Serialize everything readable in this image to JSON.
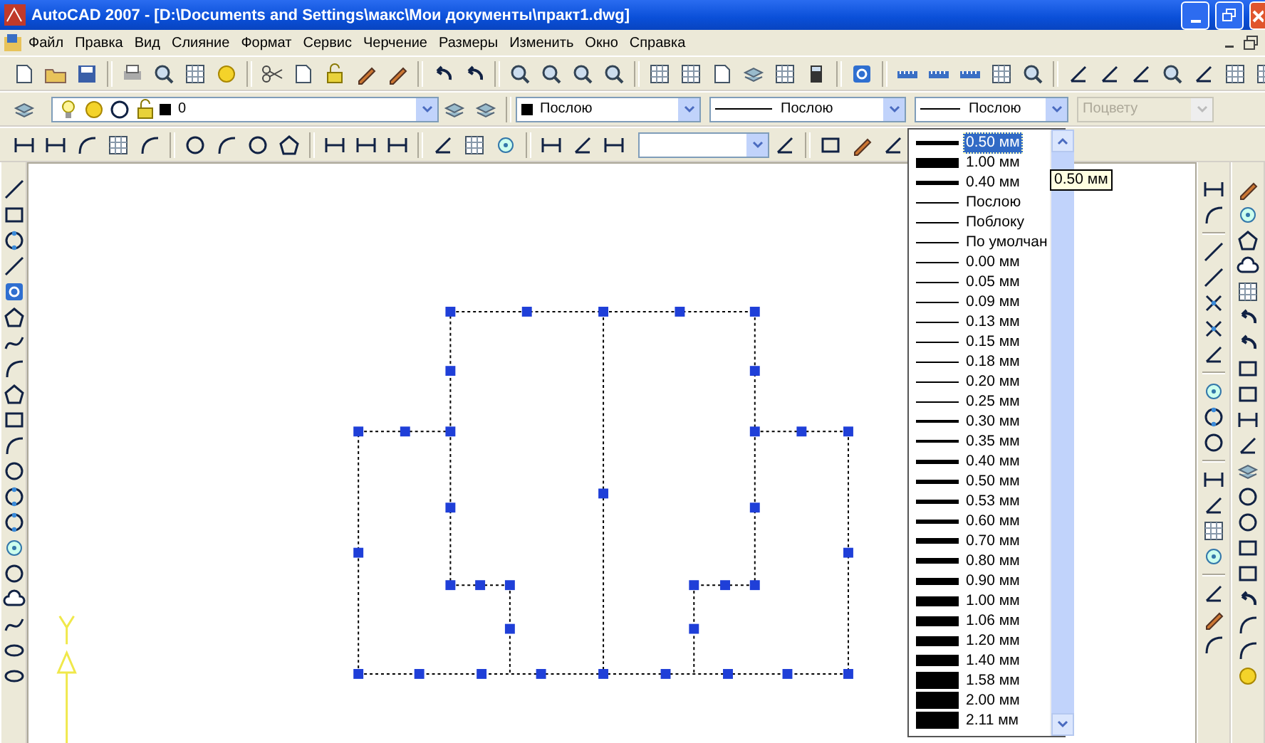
{
  "window": {
    "title": "AutoCAD 2007 - [D:\\Documents and Settings\\макс\\Мои документы\\практ1.dwg]"
  },
  "menu": [
    "Файл",
    "Правка",
    "Вид",
    "Слияние",
    "Формат",
    "Сервис",
    "Черчение",
    "Размеры",
    "Изменить",
    "Окно",
    "Справка"
  ],
  "properties_bar": {
    "layer": {
      "value": "0"
    },
    "color": {
      "value": "Послою"
    },
    "linetype": {
      "value": "Послою"
    },
    "lineweight": {
      "value": "Послою"
    },
    "plot_style": {
      "value": "Поцвету",
      "disabled": true
    }
  },
  "lineweight_list": {
    "tooltip": "0.50 мм",
    "items": [
      {
        "label": "0.50 мм",
        "kind": "medium",
        "selected": true
      },
      {
        "label": "1.00 мм",
        "kind": "heavy",
        "selected": false
      },
      {
        "label": "0.40 мм",
        "kind": "medium",
        "selected": false
      },
      {
        "label": "Послою",
        "kind": "hairline",
        "selected": false
      },
      {
        "label": "Поблоку",
        "kind": "hairline",
        "selected": false
      },
      {
        "label": "По умолчан",
        "kind": "hairline",
        "selected": false
      },
      {
        "label": "0.00 мм",
        "kind": "hairline",
        "selected": false
      },
      {
        "label": "0.05 мм",
        "kind": "hairline",
        "selected": false
      },
      {
        "label": "0.09 мм",
        "kind": "hairline",
        "selected": false
      },
      {
        "label": "0.13 мм",
        "kind": "hairline",
        "selected": false
      },
      {
        "label": "0.15 мм",
        "kind": "hairline",
        "selected": false
      },
      {
        "label": "0.18 мм",
        "kind": "hairline",
        "selected": false
      },
      {
        "label": "0.20 мм",
        "kind": "hairline",
        "selected": false
      },
      {
        "label": "0.25 мм",
        "kind": "hairline",
        "selected": false
      },
      {
        "label": "0.30 мм",
        "kind": "thin",
        "selected": false
      },
      {
        "label": "0.35 мм",
        "kind": "thin",
        "selected": false
      },
      {
        "label": "0.40 мм",
        "kind": "medium",
        "selected": false
      },
      {
        "label": "0.50 мм",
        "kind": "medium",
        "selected": false
      },
      {
        "label": "0.53 мм",
        "kind": "medium",
        "selected": false
      },
      {
        "label": "0.60 мм",
        "kind": "medium",
        "selected": false
      },
      {
        "label": "0.70 мм",
        "kind": "thick",
        "selected": false
      },
      {
        "label": "0.80 мм",
        "kind": "thick",
        "selected": false
      },
      {
        "label": "0.90 мм",
        "kind": "bold",
        "selected": false
      },
      {
        "label": "1.00 мм",
        "kind": "heavy",
        "selected": false
      },
      {
        "label": "1.06 мм",
        "kind": "heavy",
        "selected": false
      },
      {
        "label": "1.20 мм",
        "kind": "heavy",
        "selected": false
      },
      {
        "label": "1.40 мм",
        "kind": "black",
        "selected": false
      },
      {
        "label": "1.58 мм",
        "kind": "solid",
        "selected": false
      },
      {
        "label": "2.00 мм",
        "kind": "solid",
        "selected": false
      },
      {
        "label": "2.11 мм",
        "kind": "solid",
        "selected": false
      }
    ]
  }
}
